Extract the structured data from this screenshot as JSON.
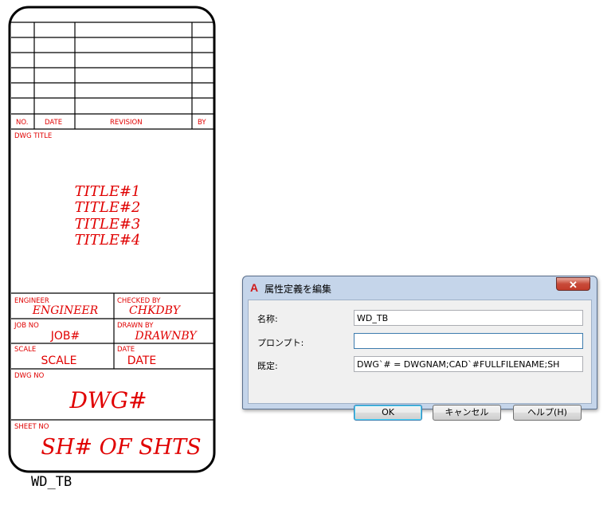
{
  "title_block": {
    "revision_header": {
      "no": "NO.",
      "date": "DATE",
      "revision": "REVISION",
      "by": "BY"
    },
    "dwg_title_label": "DWG TITLE",
    "titles": [
      "TITLE#1",
      "TITLE#2",
      "TITLE#3",
      "TITLE#4"
    ],
    "engineer_label": "ENGINEER",
    "engineer_value": "ENGINEER",
    "checked_label": "CHECKED BY",
    "checked_value": "CHKDBY",
    "job_label": "JOB NO",
    "job_value": "JOB#",
    "drawn_label": "DRAWN BY",
    "drawn_value": "DRAWNBY",
    "scale_label": "SCALE",
    "scale_value": "SCALE",
    "date_label": "DATE",
    "date_value": "DATE",
    "dwg_no_label": "DWG NO",
    "dwg_no_value": "DWG#",
    "sheet_label": "SHEET NO",
    "sheet_value": "SH# OF SHTS",
    "block_name": "WD_TB",
    "colors": {
      "text": "#e00000",
      "lines": "#000000"
    }
  },
  "dialog": {
    "title": "属性定義を編集",
    "icon": "autocad-logo-icon",
    "close_glyph": "✕",
    "fields": {
      "name_label": "名称:",
      "name_value": "WD_TB",
      "prompt_label": "プロンプト:",
      "prompt_value": "",
      "default_label": "既定:",
      "default_value": "DWG`# = DWGNAM;CAD`#FULLFILENAME;SH"
    },
    "buttons": {
      "ok": "OK",
      "cancel": "キャンセル",
      "help": "ヘルプ(H)"
    }
  }
}
